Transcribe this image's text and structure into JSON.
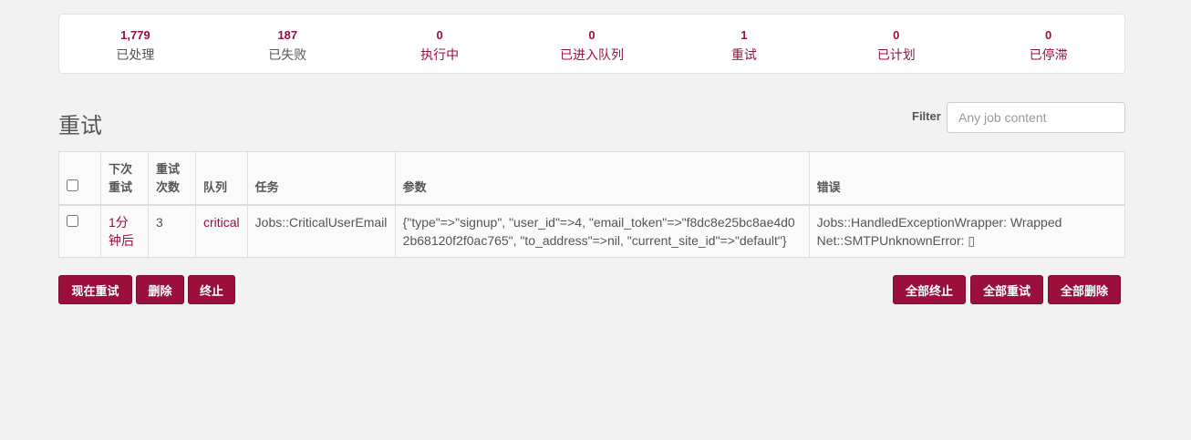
{
  "stats": [
    {
      "num": "1,779",
      "label": "已处理",
      "link": false
    },
    {
      "num": "187",
      "label": "已失败",
      "link": false
    },
    {
      "num": "0",
      "label": "执行中",
      "link": true
    },
    {
      "num": "0",
      "label": "已进入队列",
      "link": true
    },
    {
      "num": "1",
      "label": "重试",
      "link": true
    },
    {
      "num": "0",
      "label": "已计划",
      "link": true
    },
    {
      "num": "0",
      "label": "已停滞",
      "link": true
    }
  ],
  "page_title": "重试",
  "filter": {
    "label": "Filter",
    "placeholder": "Any job content"
  },
  "table": {
    "headers": [
      "下次重试",
      "重试次数",
      "队列",
      "任务",
      "参数",
      "错误"
    ],
    "rows": [
      {
        "next_retry": "1分钟后",
        "retry_count": "3",
        "queue": "critical",
        "job": "Jobs::CriticalUserEmail",
        "args": "{\"type\"=>\"signup\", \"user_id\"=>4, \"email_token\"=>\"f8dc8e25bc8ae4d02b68120f2f0ac765\", \"to_address\"=>nil, \"current_site_id\"=>\"default\"}",
        "error": "Jobs::HandledExceptionWrapper: Wrapped Net::SMTPUnknownError: ▯"
      }
    ]
  },
  "buttons": {
    "retry_now": "现在重试",
    "delete": "删除",
    "kill": "终止",
    "kill_all": "全部终止",
    "retry_all": "全部重试",
    "delete_all": "全部删除"
  }
}
